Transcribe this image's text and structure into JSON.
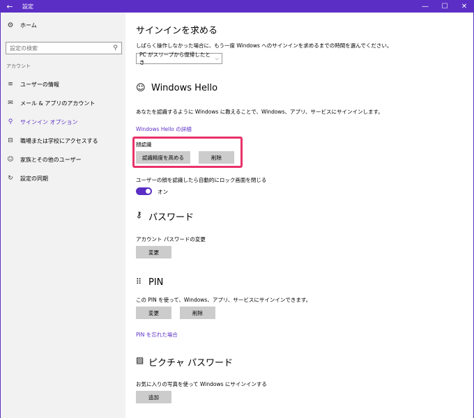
{
  "window": {
    "title": "設定",
    "back_glyph": "←",
    "min_glyph": "—",
    "max_glyph": "☐",
    "close_glyph": "✕"
  },
  "sidebar": {
    "home_label": "ホーム",
    "search_placeholder": "設定の検索",
    "section_label": "アカウント",
    "items": [
      {
        "label": "ユーザーの情報",
        "icon": "user-info-icon",
        "glyph": "≡"
      },
      {
        "label": "メール & アプリのアカウント",
        "icon": "mail-icon",
        "glyph": "✉"
      },
      {
        "label": "サインイン オプション",
        "icon": "key-icon",
        "glyph": "⚲"
      },
      {
        "label": "職場または学校にアクセスする",
        "icon": "briefcase-icon",
        "glyph": "⊟"
      },
      {
        "label": "家族とその他のユーザー",
        "icon": "people-icon",
        "glyph": "☺"
      },
      {
        "label": "設定の同期",
        "icon": "sync-icon",
        "glyph": "↻"
      }
    ],
    "active_index": 2
  },
  "main": {
    "signin_required": {
      "title": "サインインを求める",
      "description": "しばらく操作しなかった場合に、もう一度 Windows へのサインインを求めるまでの時間を選んでください。",
      "dropdown_value": "PC がスリープから復帰したとき"
    },
    "hello": {
      "title": "Windows Hello",
      "description": "あなたを認識するように Windows に教えることで、Windows、アプリ、サービスにサインインします。",
      "details_link": "Windows Hello の詳細",
      "face_label": "顔認識",
      "improve_button": "認識精度を高める",
      "remove_button": "削除",
      "auto_unlock_label": "ユーザーの顔を認識したら自動的にロック画面を閉じる",
      "toggle_state": "オン"
    },
    "password": {
      "title": "パスワード",
      "change_label": "アカウント パスワードの変更",
      "change_button": "変更"
    },
    "pin": {
      "title": "PIN",
      "description": "この PIN を使って、Windows、アプリ、サービスにサインインできます。",
      "change_button": "変更",
      "remove_button": "削除",
      "forgot_link": "PIN を忘れた場合"
    },
    "picture_password": {
      "title": "ピクチャ パスワード",
      "description": "お気に入りの写真を使って Windows にサインインする",
      "add_button": "追加"
    }
  },
  "colors": {
    "accent": "#5b2fc5",
    "highlight": "#e8336a",
    "button": "#cccccc",
    "sidebar_bg": "#f2f2f2"
  }
}
